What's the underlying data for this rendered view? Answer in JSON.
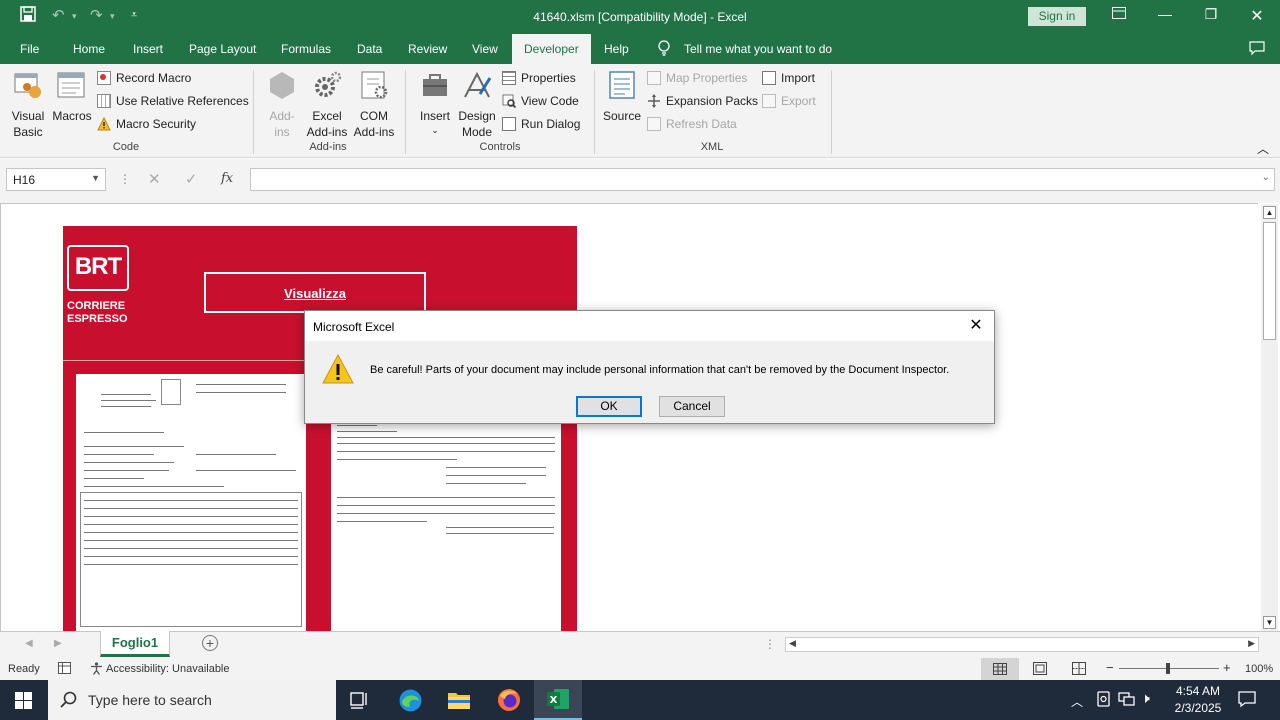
{
  "window": {
    "title": "41640.xlsm  [Compatibility Mode]  -  Excel",
    "sign_in": "Sign in"
  },
  "menu": {
    "tabs": [
      "File",
      "Home",
      "Insert",
      "Page Layout",
      "Formulas",
      "Data",
      "Review",
      "View",
      "Developer",
      "Help"
    ],
    "active": "Developer",
    "tell_me": "Tell me what you want to do"
  },
  "ribbon": {
    "code": {
      "visual_basic": [
        "Visual",
        "Basic"
      ],
      "macros": "Macros",
      "record_macro": "Record Macro",
      "use_relative": "Use Relative References",
      "macro_security": "Macro Security",
      "group": "Code"
    },
    "addins": {
      "addins": [
        "Add-",
        "ins"
      ],
      "excel_addins": [
        "Excel",
        "Add-ins"
      ],
      "com_addins": [
        "COM",
        "Add-ins"
      ],
      "group": "Add-ins"
    },
    "controls": {
      "insert": "Insert",
      "design_mode": [
        "Design",
        "Mode"
      ],
      "properties": "Properties",
      "view_code": "View Code",
      "run_dialog": "Run Dialog",
      "group": "Controls"
    },
    "xml": {
      "source": "Source",
      "map_properties": "Map Properties",
      "expansion_packs": "Expansion Packs",
      "refresh_data": "Refresh Data",
      "import": "Import",
      "export": "Export",
      "group": "XML"
    }
  },
  "formula_bar": {
    "name_box": "H16",
    "fx": "fx",
    "value": ""
  },
  "sheet": {
    "brt_logo": {
      "line1": "BRT",
      "line2": "CORRIERE",
      "line3": "ESPRESSO"
    },
    "button": "Visualizza"
  },
  "sheet_tabs": {
    "active": "Foglio1"
  },
  "status": {
    "ready": "Ready",
    "accessibility": "Accessibility: Unavailable",
    "zoom": "100%"
  },
  "taskbar": {
    "search_placeholder": "Type here to search",
    "time": "4:54 AM",
    "date": "2/3/2025"
  },
  "dialog": {
    "title": "Microsoft Excel",
    "message": "Be careful! Parts of your document may include personal information that can't be removed by the Document Inspector.",
    "ok": "OK",
    "cancel": "Cancel"
  },
  "colors": {
    "excel_green": "#217346",
    "brt_red": "#c8102e",
    "taskbar": "#1f2a3a"
  }
}
